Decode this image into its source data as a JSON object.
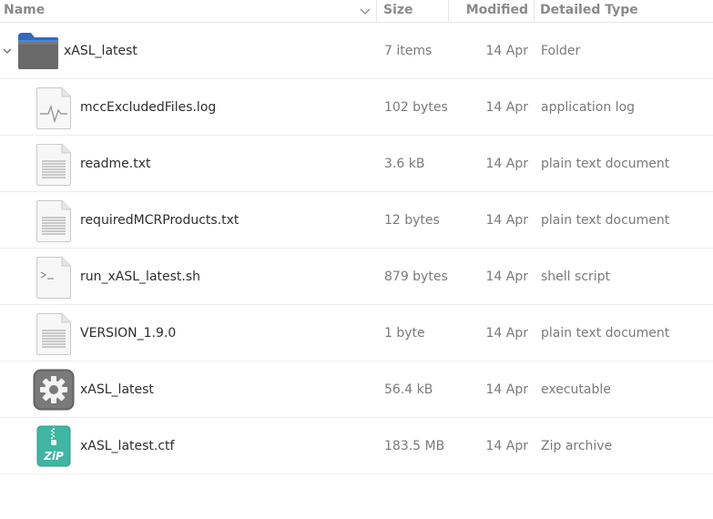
{
  "columns": {
    "name": "Name",
    "size": "Size",
    "modified": "Modified",
    "type": "Detailed Type"
  },
  "rows": [
    {
      "name": "xASL_latest",
      "size": "7 items",
      "modified": "14 Apr",
      "type": "Folder",
      "icon": "folder-icon"
    },
    {
      "name": "mccExcludedFiles.log",
      "size": "102 bytes",
      "modified": "14 Apr",
      "type": "application log",
      "icon": "log-file-icon"
    },
    {
      "name": "readme.txt",
      "size": "3.6 kB",
      "modified": "14 Apr",
      "type": "plain text document",
      "icon": "text-file-icon"
    },
    {
      "name": "requiredMCRProducts.txt",
      "size": "12 bytes",
      "modified": "14 Apr",
      "type": "plain text document",
      "icon": "text-file-icon"
    },
    {
      "name": "run_xASL_latest.sh",
      "size": "879 bytes",
      "modified": "14 Apr",
      "type": "shell script",
      "icon": "shell-script-icon"
    },
    {
      "name": "VERSION_1.9.0",
      "size": "1 byte",
      "modified": "14 Apr",
      "type": "plain text document",
      "icon": "text-file-icon"
    },
    {
      "name": "xASL_latest",
      "size": "56.4 kB",
      "modified": "14 Apr",
      "type": "executable",
      "icon": "executable-gear-icon"
    },
    {
      "name": "xASL_latest.ctf",
      "size": "183.5 MB",
      "modified": "14 Apr",
      "type": "Zip archive",
      "icon": "zip-archive-icon"
    }
  ],
  "zip_icon_text": "ZiP",
  "colors": {
    "folder": "#3f7fd8",
    "executable": "#6e6e6e",
    "zip": "#3fb5a3"
  }
}
